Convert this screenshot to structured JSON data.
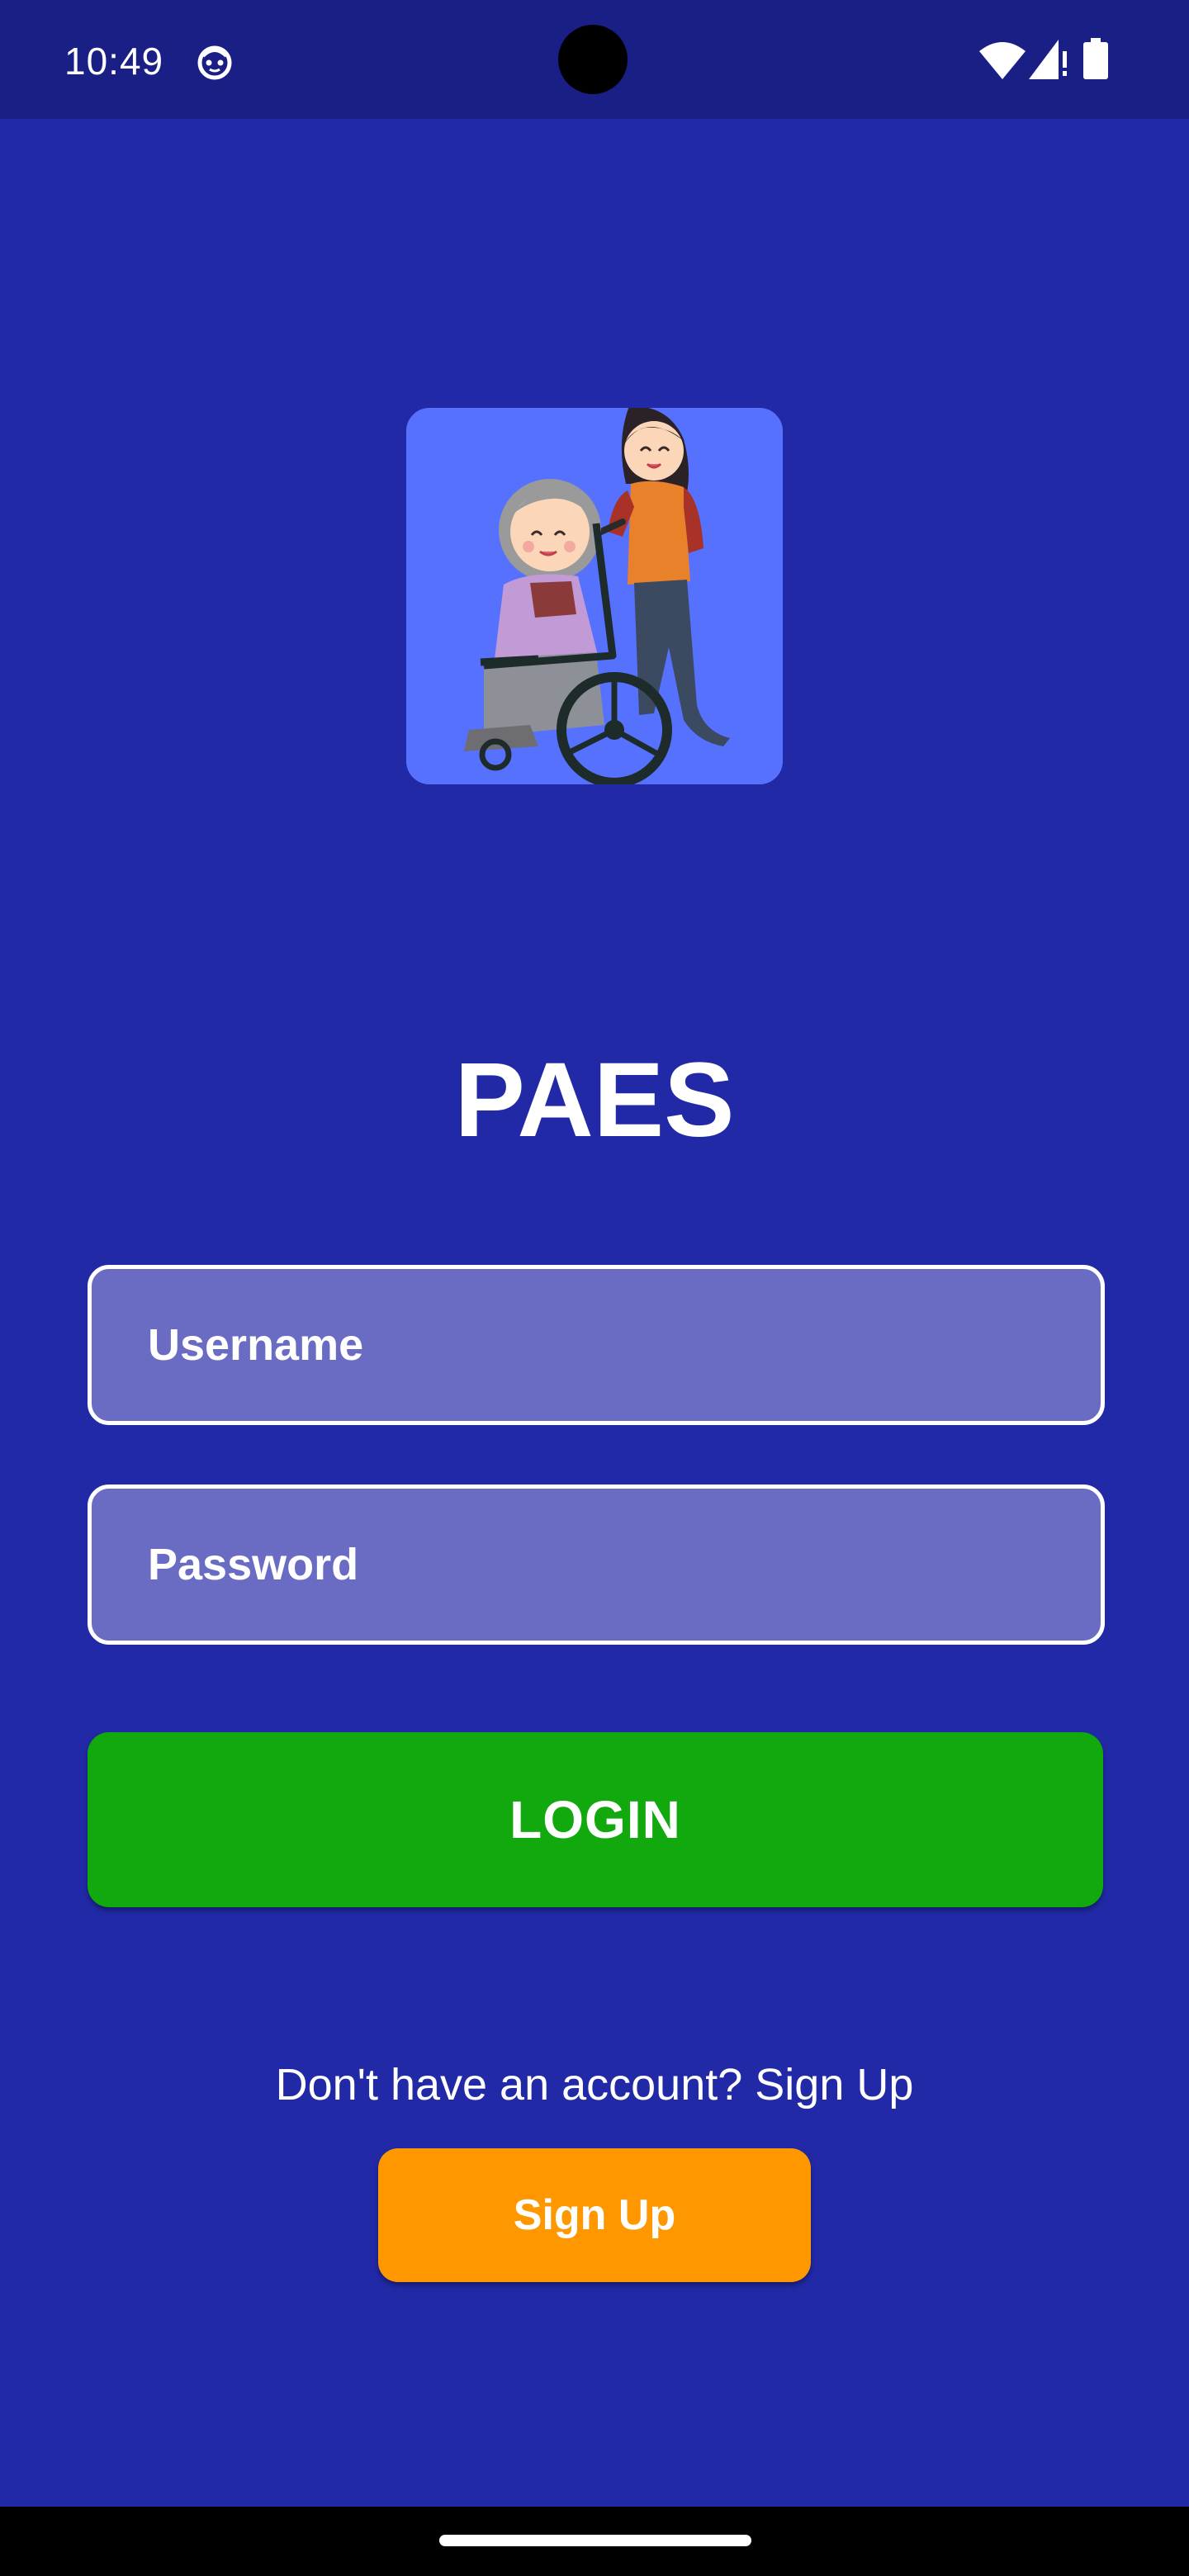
{
  "status_bar": {
    "time": "10:49",
    "app_icon": "android-debug-icon",
    "wifi_icon": "wifi-icon",
    "signal_icon": "cell-signal-icon",
    "battery_icon": "battery-icon"
  },
  "logo": {
    "icon": "caregiver-wheelchair-illustration",
    "background_color": "#5771ff"
  },
  "app": {
    "title": "PAES"
  },
  "form": {
    "username_placeholder": "Username",
    "username_value": "",
    "password_placeholder": "Password",
    "password_value": "",
    "login_label": "LOGIN"
  },
  "signup": {
    "prompt": "Don't have an account? Sign Up",
    "button_label": "Sign Up"
  },
  "colors": {
    "background": "#2129a6",
    "status_bar": "#1a1f85",
    "field_fill": "#6a6cc3",
    "login_button": "#12a90e",
    "signup_button": "#ff9800"
  }
}
